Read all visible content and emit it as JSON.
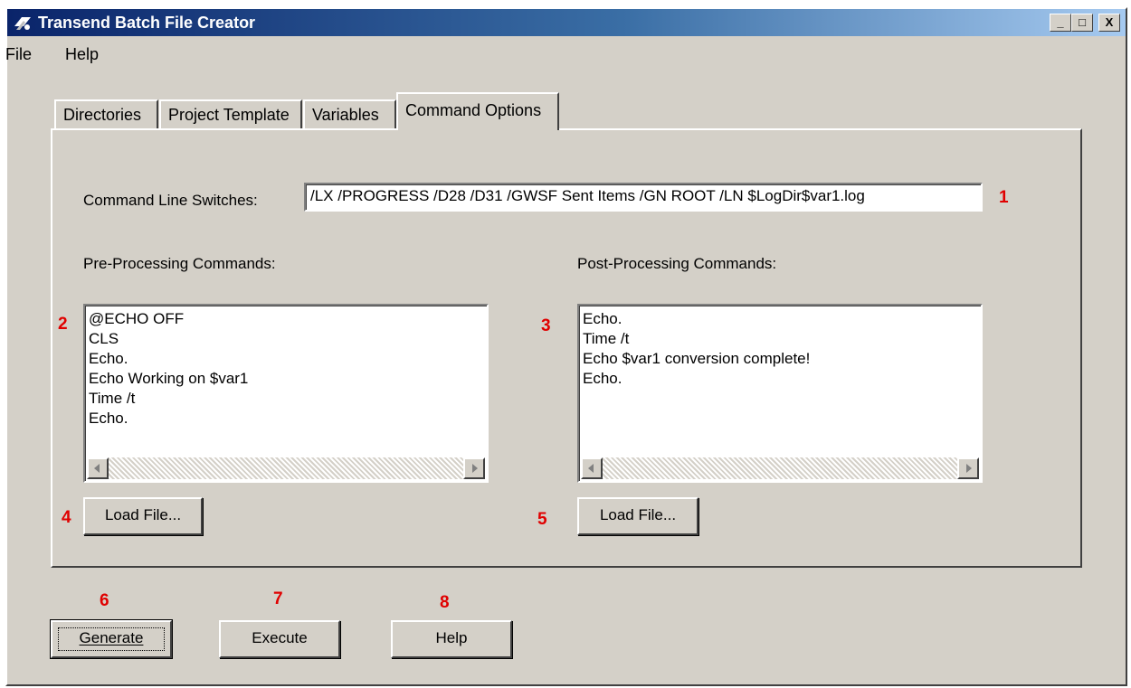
{
  "window": {
    "title": "Transend Batch File Creator",
    "minimize": "_",
    "maximize": "□",
    "close": "X"
  },
  "menu": {
    "file": "File",
    "help": "Help"
  },
  "tabs": [
    "Directories",
    "Project Template",
    "Variables",
    "Command Options"
  ],
  "command_line": {
    "label": "Command Line Switches:",
    "value": "/LX /PROGRESS /D28 /D31 /GWSF Sent Items /GN ROOT /LN $LogDir$var1.log"
  },
  "pre_processing": {
    "label": "Pre-Processing Commands:",
    "lines": [
      "@ECHO OFF",
      "CLS",
      "Echo.",
      "Echo Working on $var1",
      "Time /t",
      "Echo."
    ],
    "load_button": "Load File..."
  },
  "post_processing": {
    "label": "Post-Processing Commands:",
    "lines": [
      "Echo.",
      "Time /t",
      "Echo $var1 conversion complete!",
      "Echo."
    ],
    "load_button": "Load File..."
  },
  "buttons": {
    "generate": "Generate",
    "execute": "Execute",
    "help": "Help"
  },
  "annotations": [
    "1",
    "2",
    "3",
    "4",
    "5",
    "6",
    "7",
    "8"
  ],
  "colors": {
    "titlebar_start": "#0a246a",
    "titlebar_end": "#a6caf0",
    "face": "#d4d0c8",
    "annotation": "#e00000"
  }
}
